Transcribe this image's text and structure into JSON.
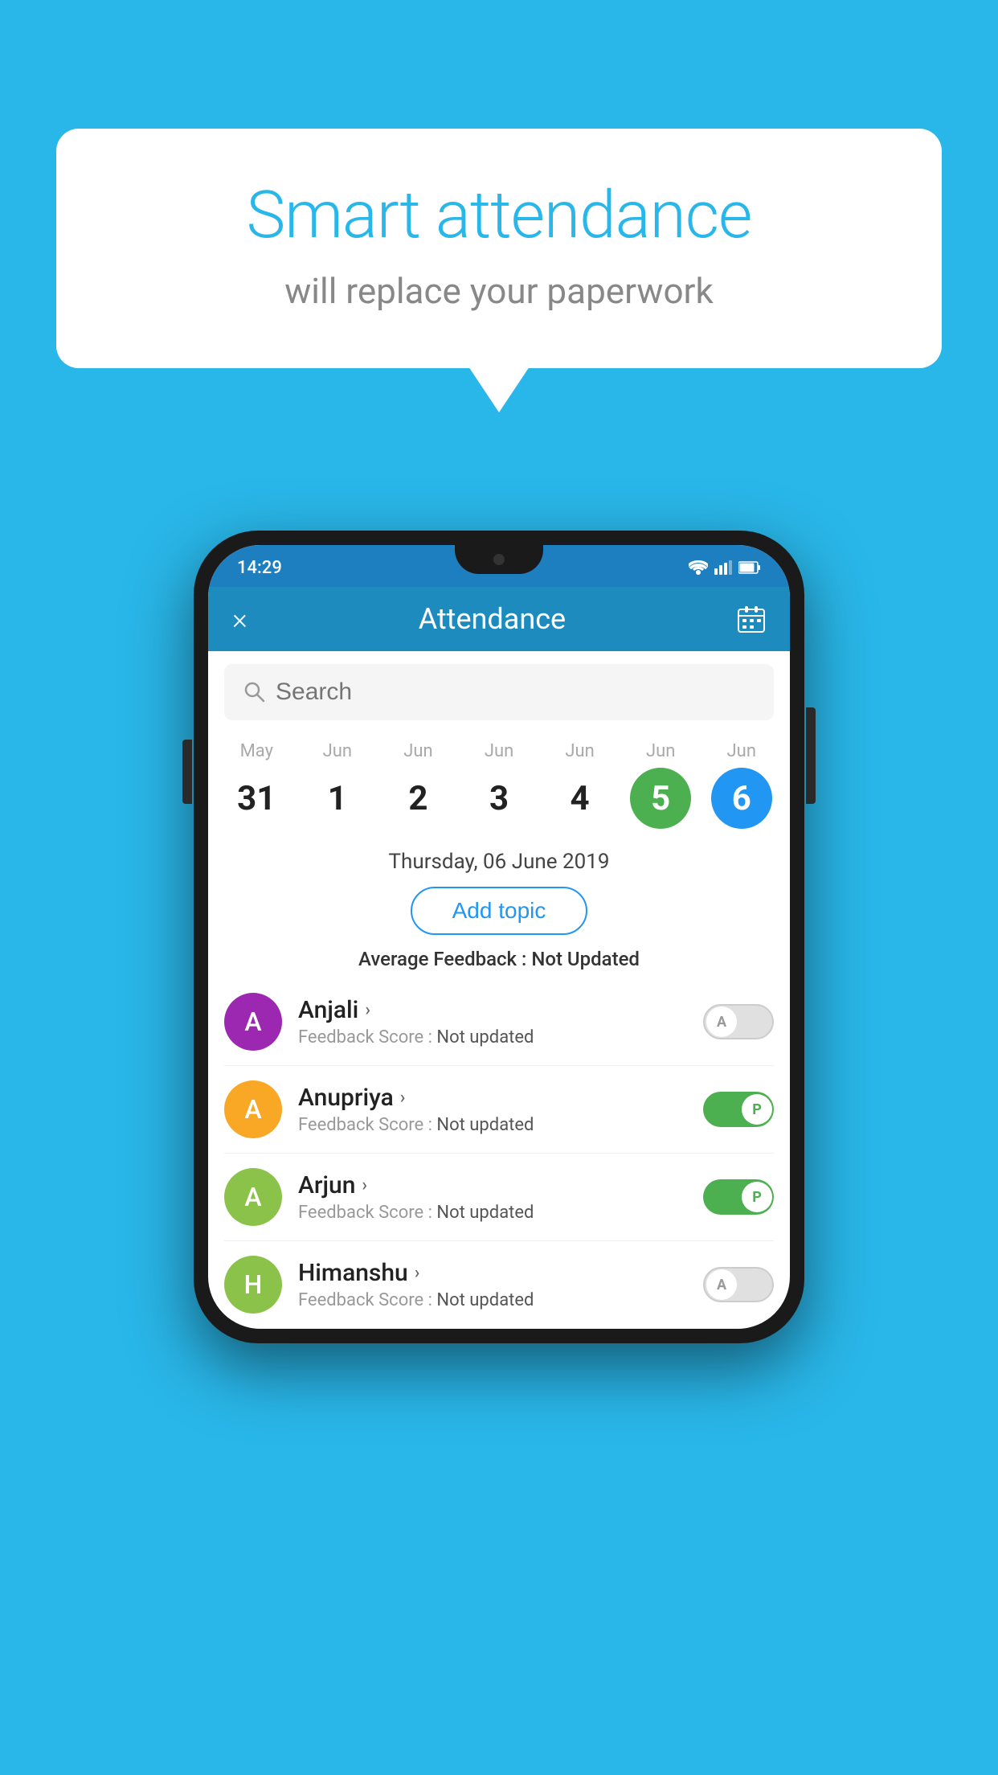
{
  "background_color": "#29b6e8",
  "bubble": {
    "title": "Smart attendance",
    "subtitle": "will replace your paperwork"
  },
  "status_bar": {
    "time": "14:29",
    "wifi": "▼",
    "signal": "▲",
    "battery": "■"
  },
  "app_bar": {
    "title": "Attendance",
    "close_label": "×",
    "calendar_label": "📅"
  },
  "search": {
    "placeholder": "Search"
  },
  "dates": [
    {
      "month": "May",
      "day": "31",
      "state": "normal"
    },
    {
      "month": "Jun",
      "day": "1",
      "state": "normal"
    },
    {
      "month": "Jun",
      "day": "2",
      "state": "normal"
    },
    {
      "month": "Jun",
      "day": "3",
      "state": "normal"
    },
    {
      "month": "Jun",
      "day": "4",
      "state": "normal"
    },
    {
      "month": "Jun",
      "day": "5",
      "state": "today"
    },
    {
      "month": "Jun",
      "day": "6",
      "state": "selected"
    }
  ],
  "selected_date_label": "Thursday, 06 June 2019",
  "add_topic_label": "Add topic",
  "avg_feedback_label": "Average Feedback :",
  "avg_feedback_value": "Not Updated",
  "students": [
    {
      "name": "Anjali",
      "initial": "A",
      "avatar_color": "#9c27b0",
      "feedback_label": "Feedback Score :",
      "feedback_value": "Not updated",
      "attendance": "absent",
      "toggle_letter": "A"
    },
    {
      "name": "Anupriya",
      "initial": "A",
      "avatar_color": "#f9a825",
      "feedback_label": "Feedback Score :",
      "feedback_value": "Not updated",
      "attendance": "present",
      "toggle_letter": "P"
    },
    {
      "name": "Arjun",
      "initial": "A",
      "avatar_color": "#8bc34a",
      "feedback_label": "Feedback Score :",
      "feedback_value": "Not updated",
      "attendance": "present",
      "toggle_letter": "P"
    },
    {
      "name": "Himanshu",
      "initial": "H",
      "avatar_color": "#8bc34a",
      "feedback_label": "Feedback Score :",
      "feedback_value": "Not updated",
      "attendance": "absent",
      "toggle_letter": "A"
    }
  ]
}
